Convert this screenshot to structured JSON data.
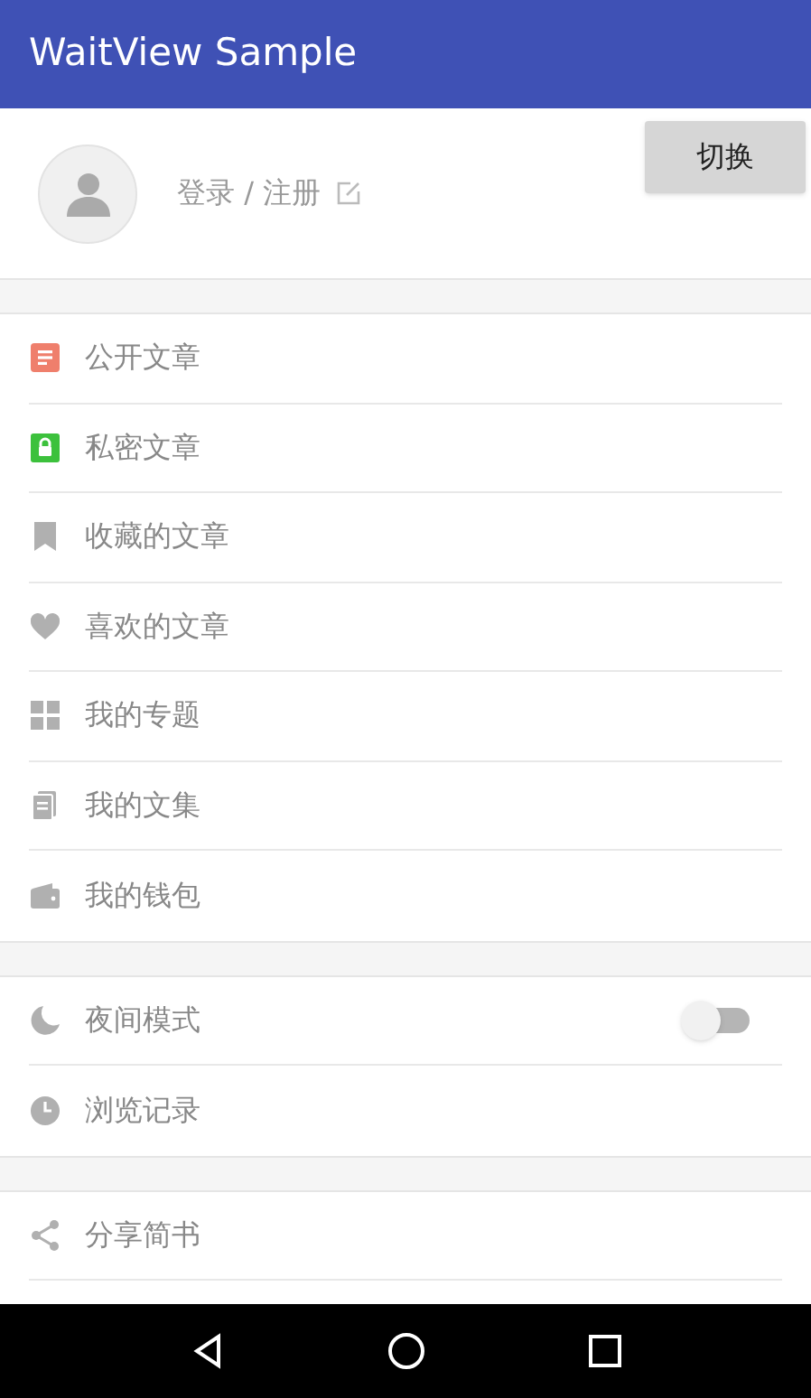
{
  "app_bar": {
    "title": "WaitView Sample"
  },
  "profile": {
    "login_text": "登录 / 注册"
  },
  "switch_button": {
    "label": "切换"
  },
  "groups": [
    {
      "items": [
        {
          "kind": "link",
          "label": "公开文章"
        },
        {
          "kind": "link",
          "label": "私密文章"
        },
        {
          "kind": "link",
          "label": "收藏的文章"
        },
        {
          "kind": "link",
          "label": "喜欢的文章"
        },
        {
          "kind": "link",
          "label": "我的专题"
        },
        {
          "kind": "link",
          "label": "我的文集"
        },
        {
          "kind": "link",
          "label": "我的钱包"
        }
      ]
    },
    {
      "items": [
        {
          "kind": "toggle",
          "label": "夜间模式",
          "on": false
        },
        {
          "kind": "link",
          "label": "浏览记录"
        }
      ]
    },
    {
      "items": [
        {
          "kind": "link",
          "label": "分享简书"
        }
      ]
    }
  ]
}
